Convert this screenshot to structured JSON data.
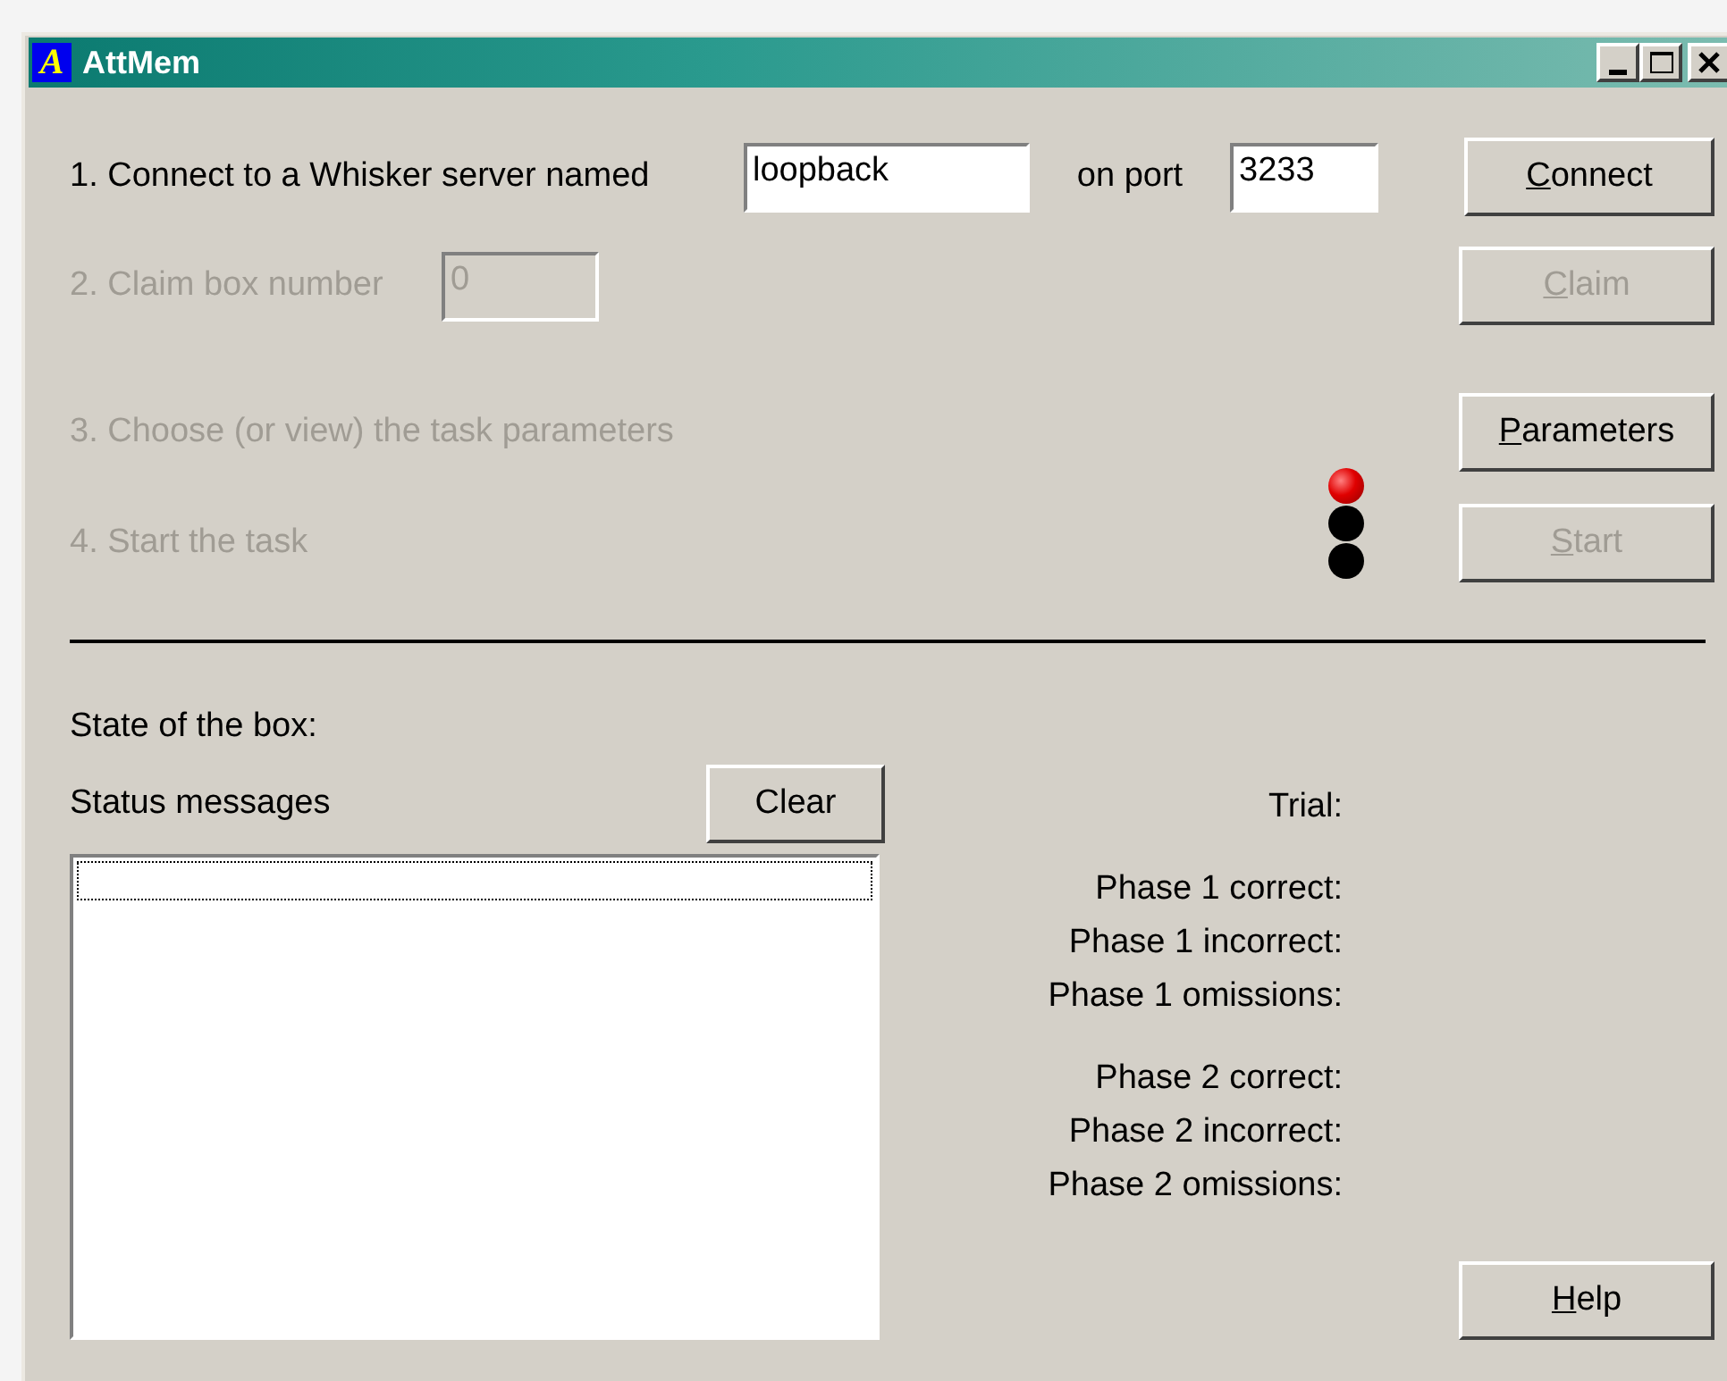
{
  "window": {
    "title": "AttMem",
    "icon_letter": "A"
  },
  "steps": [
    {
      "label": "1. Connect to a Whisker server named",
      "disabled": false
    },
    {
      "label": "2. Claim box number",
      "disabled": true
    },
    {
      "label": "3. Choose (or view) the task parameters",
      "disabled": true
    },
    {
      "label": "4. Start the task",
      "disabled": true
    }
  ],
  "server_field": {
    "value": "loopback"
  },
  "port_label": "on port",
  "port_field": {
    "value": "3233"
  },
  "box_field": {
    "value": "0",
    "disabled": true
  },
  "buttons": [
    {
      "label": "Connect",
      "mnemonic": true,
      "disabled": false
    },
    {
      "label": "Claim",
      "mnemonic": true,
      "disabled": true
    },
    {
      "label": "Parameters",
      "mnemonic": true,
      "disabled": false
    },
    {
      "label": "Start",
      "mnemonic": true,
      "disabled": true
    }
  ],
  "lights": [
    {
      "on": true
    },
    {
      "on": false
    },
    {
      "on": false
    }
  ],
  "state_label": "State of the box:",
  "status_label": "Status messages",
  "clear_button": {
    "label": "Clear"
  },
  "status_list": {
    "focused": true
  },
  "stat_groups": [
    {
      "labels": [
        "Trial:"
      ]
    },
    {
      "labels": [
        "Phase 1 correct:",
        "Phase 1 incorrect:",
        "Phase 1 omissions:"
      ]
    },
    {
      "labels": [
        "Phase 2 correct:",
        "Phase 2 incorrect:",
        "Phase 2 omissions:"
      ]
    }
  ],
  "help_button": {
    "label": "Help",
    "mnemonic": true
  }
}
